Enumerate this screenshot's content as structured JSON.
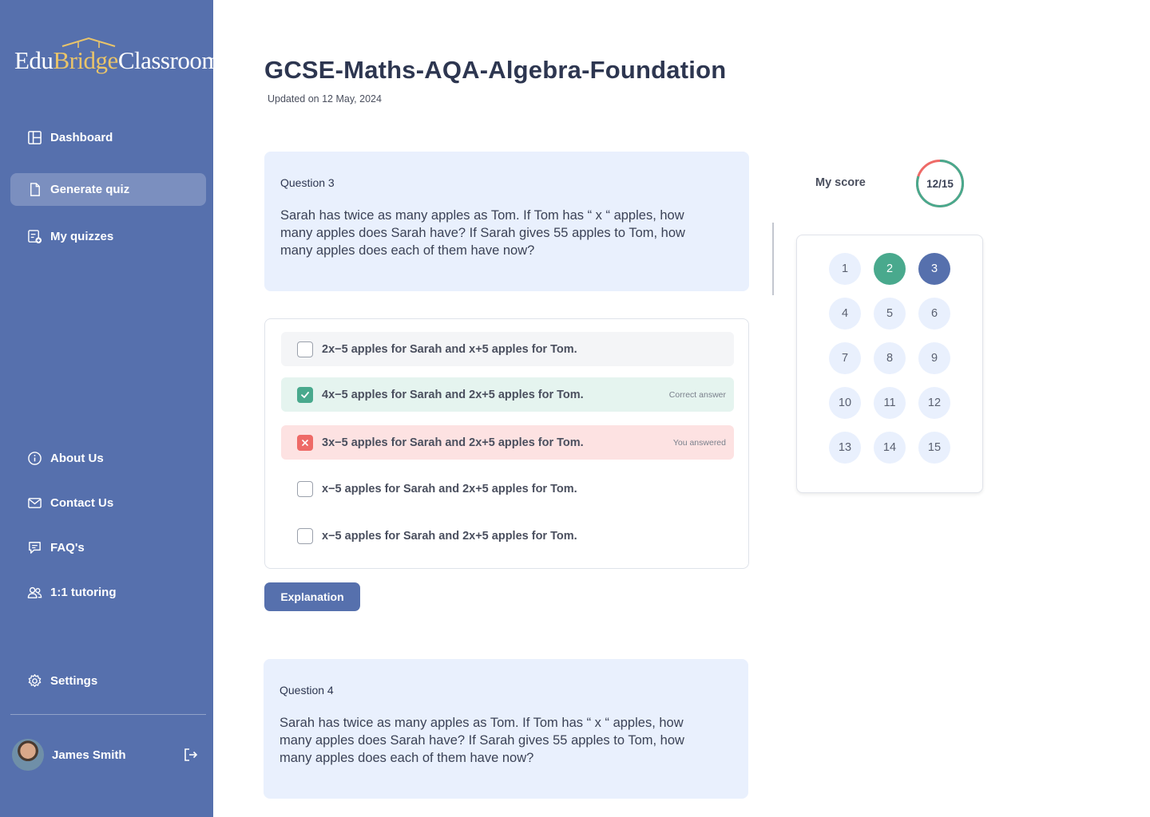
{
  "brand": {
    "part1": "Edu",
    "part2": "Bridge",
    "part3": "Classroom",
    "accent_color": "#e9c46a"
  },
  "sidebar": {
    "bg_color": "#5670ad",
    "items": [
      {
        "label": "Dashboard",
        "icon": "layout-icon"
      },
      {
        "label": "Generate quiz",
        "icon": "document-icon",
        "active": true
      },
      {
        "label": "My quizzes",
        "icon": "quiz-list-icon"
      },
      {
        "label": "About Us",
        "icon": "info-icon"
      },
      {
        "label": "Contact Us",
        "icon": "mail-icon"
      },
      {
        "label": "FAQ's",
        "icon": "chat-icon"
      },
      {
        "label": "1:1 tutoring",
        "icon": "users-icon"
      },
      {
        "label": "Settings",
        "icon": "gear-icon"
      }
    ],
    "user": {
      "name": "James Smith"
    }
  },
  "page": {
    "title": "GCSE-Maths-AQA-Algebra-Foundation",
    "updated": "Updated on 12 May, 2024"
  },
  "questions": [
    {
      "label": "Question 3",
      "text": "Sarah has twice as many apples as Tom. If Tom has “ x “ apples, how many apples does Sarah have? If Sarah gives 55 apples to Tom, how many apples does each of them have now?",
      "options": [
        {
          "text": "2x−5 apples for Sarah and x+5 apples for Tom.",
          "state": "neutral",
          "tag": ""
        },
        {
          "text": "4x−5 apples for Sarah and 2x+5 apples for Tom.",
          "state": "correct",
          "tag": "Correct answer"
        },
        {
          "text": "3x−5 apples for Sarah and 2x+5 apples for Tom.",
          "state": "wrong",
          "tag": "You answered"
        },
        {
          "text": "x−5 apples for Sarah and 2x+5 apples for Tom.",
          "state": "none",
          "tag": ""
        },
        {
          "text": "x−5 apples for Sarah and 2x+5 apples for Tom.",
          "state": "none",
          "tag": ""
        }
      ],
      "explanation_label": "Explanation"
    },
    {
      "label": "Question 4",
      "text": "Sarah has twice as many apples as Tom. If Tom has “ x “ apples, how many apples does Sarah have? If Sarah gives 55 apples to Tom, how many apples does each of them have now?"
    }
  ],
  "score": {
    "label": "My score",
    "value": "12/15",
    "correct": 12,
    "total": 15,
    "correct_color": "#49a98d",
    "wrong_color": "#ee6a67"
  },
  "question_grid": {
    "numbers": [
      "1",
      "2",
      "3",
      "4",
      "5",
      "6",
      "7",
      "8",
      "9",
      "10",
      "11",
      "12",
      "13",
      "14",
      "15"
    ],
    "answered": "2",
    "current": "3"
  }
}
